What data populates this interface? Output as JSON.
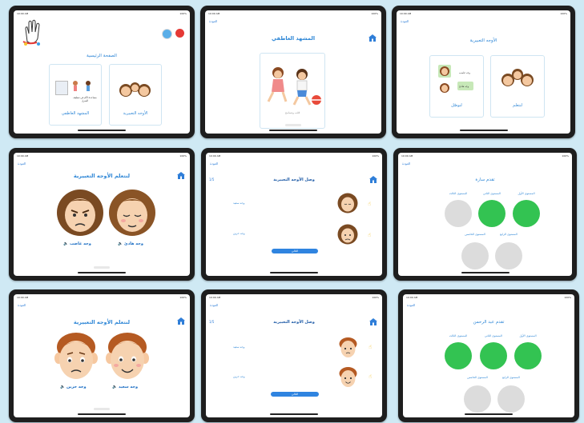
{
  "status": {
    "time": "10:09 AM",
    "date": "Sun May 4",
    "battery": "100%"
  },
  "back_label": "العودة",
  "screen1": {
    "title": "الصفحة الرئيسية",
    "card_emotions": "الأوجه التعبيرية",
    "card_scene": "المشهد العاطفي",
    "scene_caption": "مساعدة الأم في تنظيف المنزل"
  },
  "screen2": {
    "title": "المشهد العاطفي",
    "caption": "قلب وتسامح"
  },
  "screen3": {
    "title": "الأوجه التعبيرية",
    "card_learn": "لنتعلم",
    "card_match": "لنوصّل",
    "chip_1": "وجه غاضب",
    "chip_2": "وجه هادئ"
  },
  "screen4": {
    "title": "لنتعلم الأوجه التعبيرية",
    "label_calm": "وجه هادئ",
    "label_angry": "وجه غاضب"
  },
  "screen5": {
    "title": "وصل الأوجه التعبيرية",
    "counter": "1/5",
    "label_1": "وجه سعيد",
    "label_2": "وجه حزين",
    "button": "التالي"
  },
  "screen6": {
    "title": "تقدم سارة",
    "levels": [
      "المستوى الأول",
      "المستوى الثاني",
      "المستوى الثالث",
      "المستوى الرابع",
      "المستوى الخامس"
    ]
  },
  "screen7": {
    "title": "لنتعلم الأوجه التعبيرية",
    "label_happy": "وجه سعيد",
    "label_sad": "وجه حزين"
  },
  "screen8": {
    "title": "وصل الأوجه التعبيرية",
    "counter": "1/5",
    "label_1": "وجه سعيد",
    "label_2": "وجه حزين",
    "button": "التالي"
  },
  "screen9": {
    "title": "تقدم عبد الرحمن",
    "levels": [
      "المستوى الأول",
      "المستوى الثاني",
      "المستوى الثالث",
      "المستوى الرابع",
      "المستوى الخامس"
    ]
  },
  "colors": {
    "accent": "#2d86d6",
    "complete": "#33c352",
    "incomplete": "#dcdcdc",
    "background": "#cfe9f4"
  }
}
